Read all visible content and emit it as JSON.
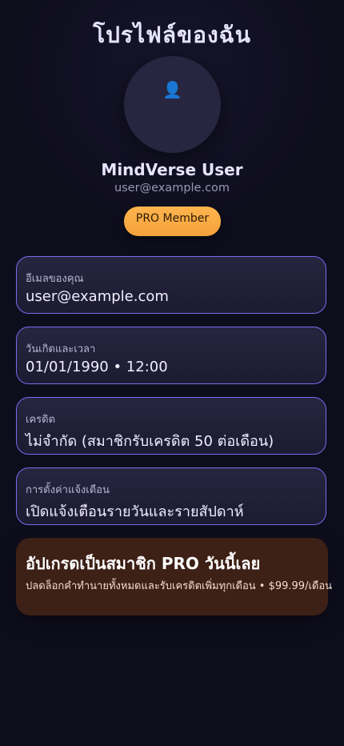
{
  "page": {
    "title": "โปรไฟล์ของฉัน"
  },
  "profile": {
    "avatar_icon": "user-icon",
    "avatar_glyph": "👤",
    "name": "MindVerse User",
    "email": "user@example.com",
    "badge": "PRO Member"
  },
  "fields": [
    {
      "label": "อีเมลของคุณ",
      "value": "user@example.com"
    },
    {
      "label": "วันเกิดและเวลา",
      "value": "01/01/1990 • 12:00"
    },
    {
      "label": "เครดิต",
      "value": "ไม่จำกัด (สมาชิกรับเครดิต 50 ต่อเดือน)"
    },
    {
      "label": "การตั้งค่าแจ้งเตือน",
      "value": "เปิดแจ้งเตือนรายวันและรายสัปดาห์"
    }
  ],
  "upsell": {
    "title": "อัปเกรดเป็นสมาชิก PRO วันนี้เลย",
    "subtitle": "ปลดล็อกคำทำนายทั้งหมดและรับเครดิตเพิ่มทุกเดือน • $99.99/เดือน"
  },
  "colors": {
    "background": "#0e0d1c",
    "card_border": "#7a6af0",
    "badge": "#f4a23c",
    "upsell_background": "#3d2016"
  }
}
